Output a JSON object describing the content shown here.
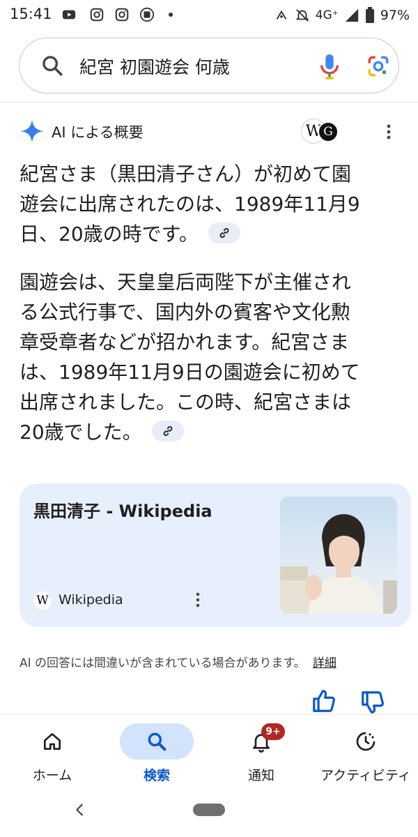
{
  "status_bar": {
    "time": "15:41",
    "network": "4G⁺",
    "battery": "97%"
  },
  "search": {
    "query": "紀宮 初園遊会 何歳"
  },
  "ai_overview": {
    "title": "AI による概要",
    "source_badge_letter": "W",
    "source_badge_letter2": "G",
    "paragraph1_lines": [
      "紀宮さま（黒田清子さん）が初めて園",
      "遊会に出席されたのは、1989年11月9",
      "日、20歳の時です。"
    ],
    "paragraph2_lines": [
      "園遊会は、天皇皇后両陛下が主催され",
      "る公式行事で、国内外の賓客や文化勲",
      "章受章者などが招かれます。紀宮さま",
      "は、1989年11月9日の園遊会に初めて",
      "出席されました。この時、紀宮さまは",
      "20歳でした。"
    ]
  },
  "source_card": {
    "title": "黒田清子 - Wikipedia",
    "source_icon_letter": "W",
    "source_name": "Wikipedia"
  },
  "disclaimer": {
    "text": "AI の回答には間違いが含まれている場合があります。",
    "more_link": "詳細"
  },
  "bottom_nav": {
    "items": [
      {
        "label": "ホーム",
        "icon": "home-icon"
      },
      {
        "label": "検索",
        "icon": "search-icon",
        "active": true
      },
      {
        "label": "通知",
        "icon": "bell-icon",
        "badge": "9+"
      },
      {
        "label": "アクティビティ",
        "icon": "activity-icon"
      }
    ]
  },
  "colors": {
    "accent": "#0b57d0",
    "card_bg": "#e8effc",
    "badge": "#b3261e",
    "link_chip": "#e8edf7"
  }
}
